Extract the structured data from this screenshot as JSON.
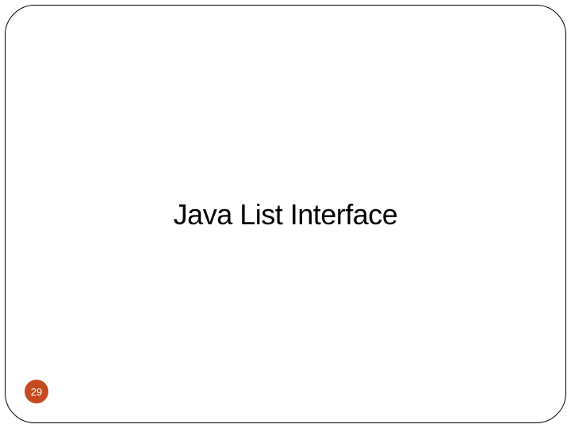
{
  "slide": {
    "title": "Java List Interface",
    "page_number": "29"
  }
}
